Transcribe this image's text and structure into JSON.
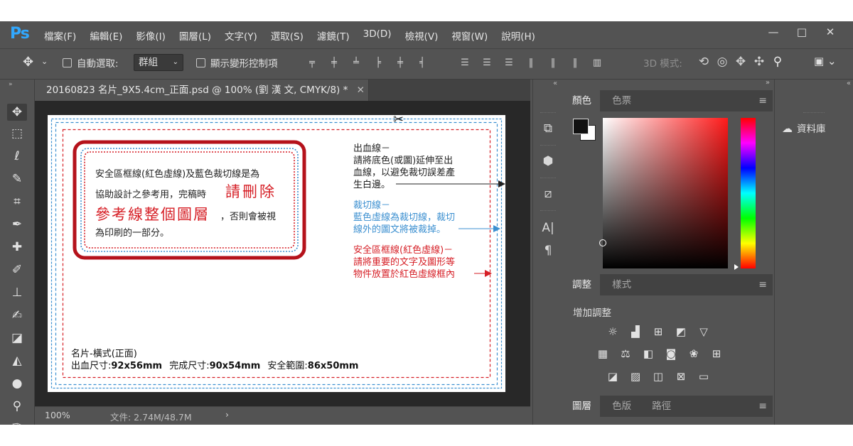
{
  "app": {
    "logo": "Ps"
  },
  "menu": [
    "檔案(F)",
    "編輯(E)",
    "影像(I)",
    "圖層(L)",
    "文字(Y)",
    "選取(S)",
    "濾鏡(T)",
    "3D(D)",
    "檢視(V)",
    "視窗(W)",
    "說明(H)"
  ],
  "window_controls": {
    "minimize": "—",
    "maximize": "□",
    "close": "✕"
  },
  "options": {
    "auto_select_label": "自動選取:",
    "auto_select_value": "群組",
    "show_transform_label": "顯示變形控制項",
    "mode_3d_label": "3D 模式:"
  },
  "document_tab": {
    "title": "20160823 名片_9X5.4cm_正面.psd @ 100% (劉 漢 文, CMYK/8) *",
    "close": "✕"
  },
  "status": {
    "zoom": "100%",
    "file_info": "文件: 2.74M/48.7M",
    "arrow": "›"
  },
  "doc": {
    "scissors": "✂",
    "safe_box_line1": "安全區框線(紅色虛線)及藍色裁切線是為",
    "safe_box_line2a": "協助設計之參考用，完稿時",
    "safe_box_line2b": "請刪除",
    "safe_box_line3a": "參考線整個圖層",
    "safe_box_line3b": "，否則會被視",
    "safe_box_line4": "為印刷的一部分。",
    "bleed_title": "出血線－",
    "bleed_l1": "請將底色(或圖)延伸至出",
    "bleed_l2": "血線，以避免裁切誤差產",
    "bleed_l3": "生白邊。",
    "trim_title": "裁切線－",
    "trim_l1": "藍色虛線為裁切線，裁切",
    "trim_l2": "線外的圖文將被裁掉。",
    "safe_title": "安全區框線(紅色虛線)－",
    "safe_l1": "請將重要的文字及圖形等",
    "safe_l2": "物件放置於紅色虛線框內",
    "card_title": "名片-橫式(正面)",
    "bleed_size_label": "出血尺寸:",
    "bleed_size_value": "92x56mm",
    "finish_size_label": "完成尺寸:",
    "finish_size_value": "90x54mm",
    "safe_range_label": "安全範圍:",
    "safe_range_value": "86x50mm"
  },
  "color_panel": {
    "tabs": [
      "顏色",
      "色票"
    ],
    "menu_icon": "≡"
  },
  "adjust_panel": {
    "tabs": [
      "調整",
      "樣式"
    ],
    "add_label": "增加調整",
    "menu_icon": "≡"
  },
  "layers_panel": {
    "tabs": [
      "圖層",
      "色版",
      "路徑"
    ],
    "menu_icon": "≡"
  },
  "library": {
    "label": "資料庫"
  },
  "colors": {
    "ui_bg": "#535353",
    "canvas_bg": "#282828",
    "ps_blue": "#31a8ff",
    "doc_red": "#d61f26",
    "box_red": "#b5121b",
    "doc_blue": "#3b8fd0"
  }
}
